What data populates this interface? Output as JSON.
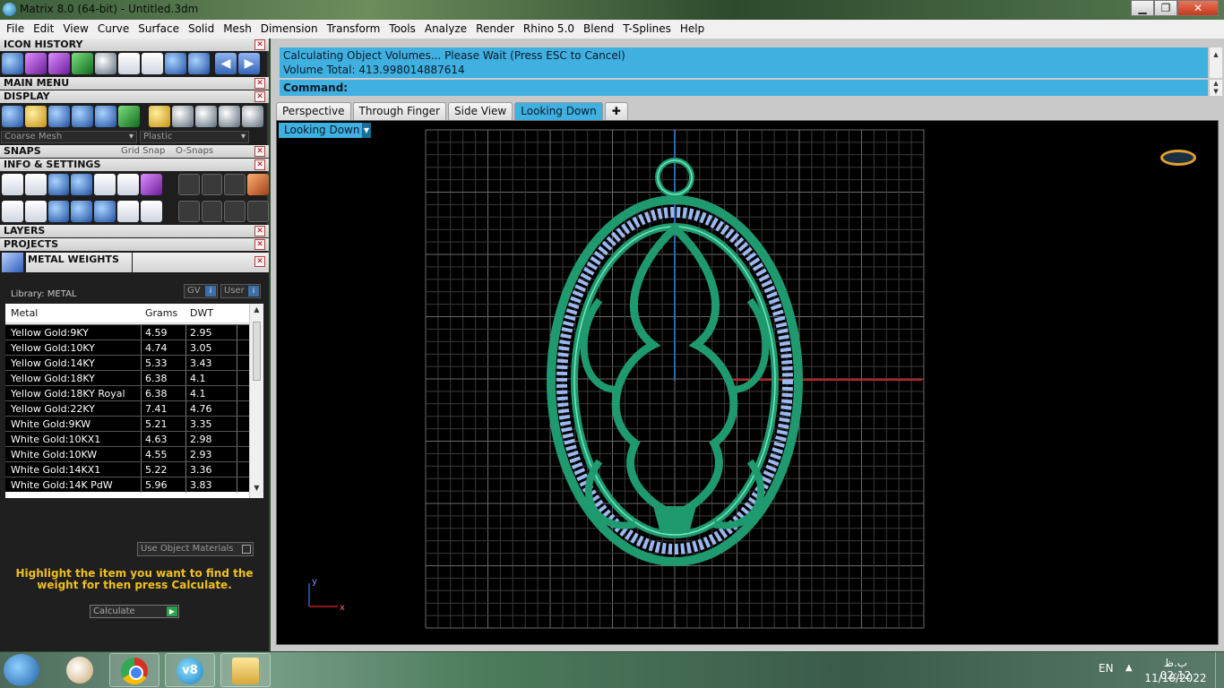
{
  "window": {
    "title": "Matrix 8.0 (64-bit) - Untitled.3dm",
    "controls": {
      "minimize": "▁",
      "maximize": "❐",
      "close": "✕"
    }
  },
  "menu": [
    "File",
    "Edit",
    "View",
    "Curve",
    "Surface",
    "Solid",
    "Mesh",
    "Dimension",
    "Transform",
    "Tools",
    "Analyze",
    "Render",
    "Rhino 5.0",
    "Blend",
    "T-Splines",
    "Help"
  ],
  "left_panel": {
    "sections": {
      "icon_history": "ICON HISTORY",
      "main_menu": "MAIN MENU",
      "display": "DISPLAY",
      "snaps": "SNAPS",
      "info_settings": "INFO & SETTINGS",
      "layers": "LAYERS",
      "projects": "PROJECTS",
      "metal_weights": "METAL WEIGHTS"
    },
    "close_glyph": "✕",
    "display_mesh": "Coarse Mesh",
    "display_material": "Plastic",
    "grid_snap": "Grid Snap",
    "o_snaps": "O-Snaps",
    "metal_weights": {
      "library_label": "Library: METAL",
      "gv_label": "GV",
      "user_label": "User",
      "columns": [
        "Metal",
        "Grams",
        "DWT"
      ],
      "rows": [
        [
          "Yellow Gold:9KY",
          "4.59",
          "2.95"
        ],
        [
          "Yellow Gold:10KY",
          "4.74",
          "3.05"
        ],
        [
          "Yellow Gold:14KY",
          "5.33",
          "3.43"
        ],
        [
          "Yellow Gold:18KY",
          "6.38",
          "4.1"
        ],
        [
          "Yellow Gold:18KY Royal",
          "6.38",
          "4.1"
        ],
        [
          "Yellow Gold:22KY",
          "7.41",
          "4.76"
        ],
        [
          "White Gold:9KW",
          "5.21",
          "3.35"
        ],
        [
          "White Gold:10KX1",
          "4.63",
          "2.98"
        ],
        [
          "White Gold:10KW",
          "4.55",
          "2.93"
        ],
        [
          "White Gold:14KX1",
          "5.22",
          "3.36"
        ],
        [
          "White Gold:14K PdW",
          "5.96",
          "3.83"
        ]
      ],
      "use_object_materials": "Use Object Materials",
      "hint": "Highlight the item you want to find the weight for then press Calculate.",
      "calculate": "Calculate"
    }
  },
  "command": {
    "output_line1": "Calculating Object Volumes... Please Wait (Press ESC to Cancel)",
    "output_line2": "Volume Total: 413.998014887614",
    "prompt": "Command:"
  },
  "tabs": [
    "Perspective",
    "Through Finger",
    "Side View",
    "Looking Down"
  ],
  "active_tab": "Looking Down",
  "add_tab": "✚",
  "viewport": {
    "label": "Looking Down",
    "axis_y": "y",
    "axis_x": "x"
  },
  "taskbar": {
    "v8_label": "v8",
    "language": "EN",
    "tray_arrow": "▲",
    "time": "ب.ظ 02:12",
    "date": "11/18/2022"
  },
  "colors": {
    "pendant": "#1f9a6e",
    "pendant_highlight": "#6fe8c0",
    "stones": "#9bb8f0",
    "accent": "#3fb0e0"
  }
}
